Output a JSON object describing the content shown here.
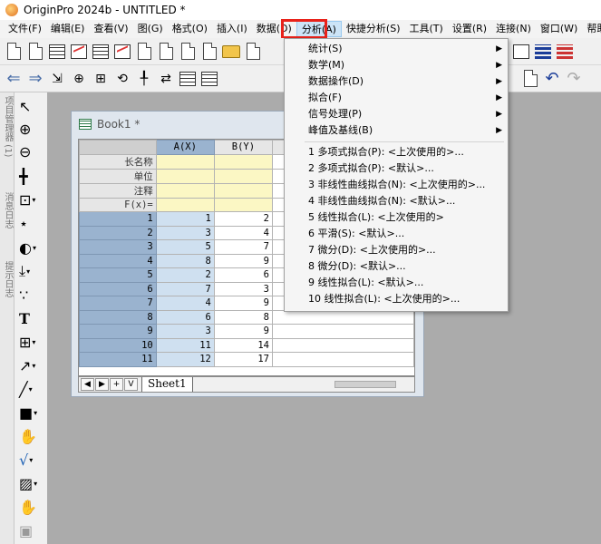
{
  "window": {
    "title": "OriginPro 2024b - UNTITLED *"
  },
  "menubar": {
    "items": [
      {
        "label": "文件(F)"
      },
      {
        "label": "编辑(E)"
      },
      {
        "label": "查看(V)"
      },
      {
        "label": "图(G)"
      },
      {
        "label": "格式(O)"
      },
      {
        "label": "插入(I)"
      },
      {
        "label": "数据(D)"
      },
      {
        "label": "分析(A)"
      },
      {
        "label": "快捷分析(S)"
      },
      {
        "label": "工具(T)"
      },
      {
        "label": "设置(R)"
      },
      {
        "label": "连接(N)"
      },
      {
        "label": "窗口(W)"
      },
      {
        "label": "帮助(H)"
      }
    ],
    "active_index": 7,
    "highlight_color": "#e8221a"
  },
  "dock_tabs": [
    "项目管理器 (1)",
    "消息日志",
    "提示日志"
  ],
  "book": {
    "title": "Book1 *",
    "columns": {
      "a": "A(X)",
      "b": "B(Y)"
    },
    "meta_rows": [
      "长名称",
      "单位",
      "注释",
      "F(x)="
    ],
    "rows": [
      {
        "n": "1",
        "a": "1",
        "b": "2"
      },
      {
        "n": "2",
        "a": "3",
        "b": "4"
      },
      {
        "n": "3",
        "a": "5",
        "b": "7"
      },
      {
        "n": "4",
        "a": "8",
        "b": "9"
      },
      {
        "n": "5",
        "a": "2",
        "b": "6"
      },
      {
        "n": "6",
        "a": "7",
        "b": "3"
      },
      {
        "n": "7",
        "a": "4",
        "b": "9"
      },
      {
        "n": "8",
        "a": "6",
        "b": "8"
      },
      {
        "n": "9",
        "a": "3",
        "b": "9"
      },
      {
        "n": "10",
        "a": "11",
        "b": "14"
      },
      {
        "n": "11",
        "a": "12",
        "b": "17"
      }
    ],
    "sheet_tab": "Sheet1",
    "tab_nav": [
      "◀",
      "▶",
      "+",
      "V"
    ]
  },
  "dropdown": {
    "submenus": [
      {
        "label": "统计(S)"
      },
      {
        "label": "数学(M)"
      },
      {
        "label": "数据操作(D)"
      },
      {
        "label": "拟合(F)"
      },
      {
        "label": "信号处理(P)"
      },
      {
        "label": "峰值及基线(B)"
      }
    ],
    "recent": [
      {
        "label": "1 多项式拟合(P): <上次使用的>..."
      },
      {
        "label": "2 多项式拟合(P): <默认>..."
      },
      {
        "label": "3 非线性曲线拟合(N): <上次使用的>..."
      },
      {
        "label": "4 非线性曲线拟合(N): <默认>..."
      },
      {
        "label": "5 线性拟合(L): <上次使用的>"
      },
      {
        "label": "6 平滑(S): <默认>..."
      },
      {
        "label": "7 微分(D): <上次使用的>..."
      },
      {
        "label": "8 微分(D): <默认>..."
      },
      {
        "label": "9 线性拟合(L): <默认>..."
      },
      {
        "label": "10 线性拟合(L): <上次使用的>..."
      }
    ]
  },
  "toolbar1_icons": [
    "new-project-icon",
    "new-folder-icon",
    "new-workbook-icon",
    "new-graph-icon",
    "new-matrix-icon",
    "new-function-icon",
    "new-notes-icon",
    "new-layout-icon",
    "new-image-icon",
    "new-excel-icon",
    "open-icon",
    "save-icon",
    "color-palette-icon",
    "bars-icon",
    "layers-icon"
  ],
  "toolbar2_icons": [
    "arrow-back-icon",
    "arrow-forward-icon",
    "import-icon",
    "add-column-icon",
    "add-rows-icon",
    "recalculate-icon",
    "pin-icon",
    "refresh-icon",
    "statistics-icon",
    "column-stats-icon",
    "copy-format-icon",
    "undo-icon",
    "redo-icon"
  ]
}
